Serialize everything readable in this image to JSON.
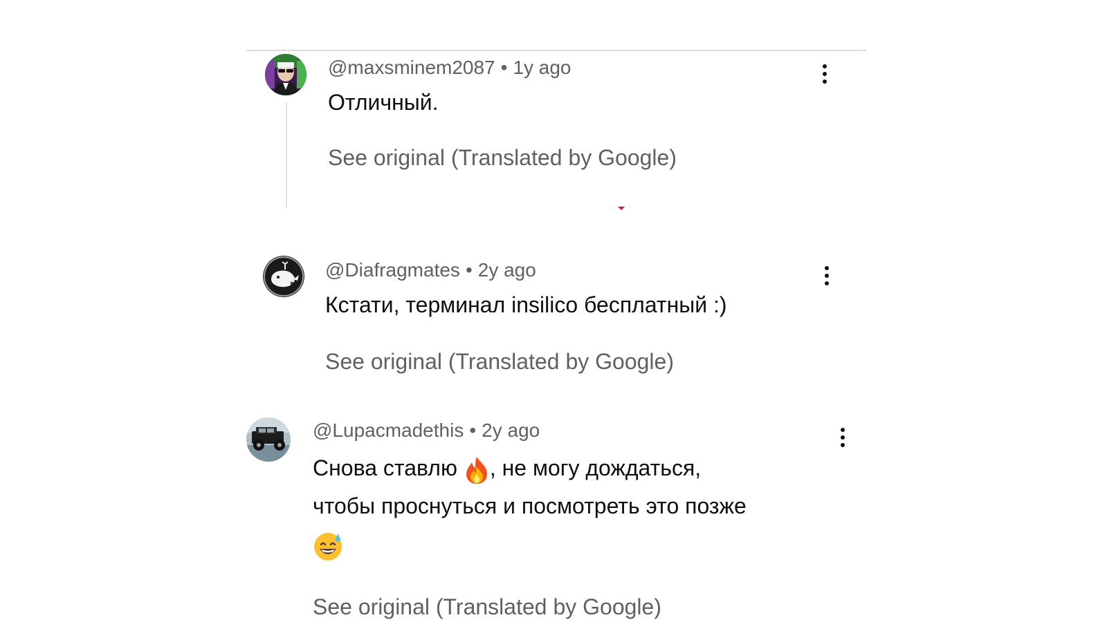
{
  "comments": [
    {
      "author": "@maxsminem2087",
      "time": "1y ago",
      "text_lines": [
        "Отличный."
      ],
      "see_original": "See original (Translated by Google)",
      "avatar_icon": "man-in-sunglasses-avatar"
    },
    {
      "author": "@Diafragmates",
      "time": "2y ago",
      "text_lines": [
        "Кстати, терминал insilico бесплатный :)"
      ],
      "see_original": "See original (Translated by Google)",
      "avatar_icon": "whale-avatar"
    },
    {
      "author": "@Lupacmadethis",
      "time": "2y ago",
      "text_before_emoji": "Снова ставлю ",
      "text_after_emoji": ", не могу дождаться,",
      "text_line2": "чтобы проснуться и посмотреть это позже",
      "emoji_1": "fire-emoji",
      "emoji_2": "grinning-sweat-emoji",
      "see_original": "See original (Translated by Google)",
      "avatar_icon": "jeep-avatar"
    }
  ],
  "colors": {
    "meta": "#606060",
    "text": "#0f0f0f",
    "divider": "#dcdcdc",
    "accent": "#e0153a"
  },
  "separator": "•"
}
